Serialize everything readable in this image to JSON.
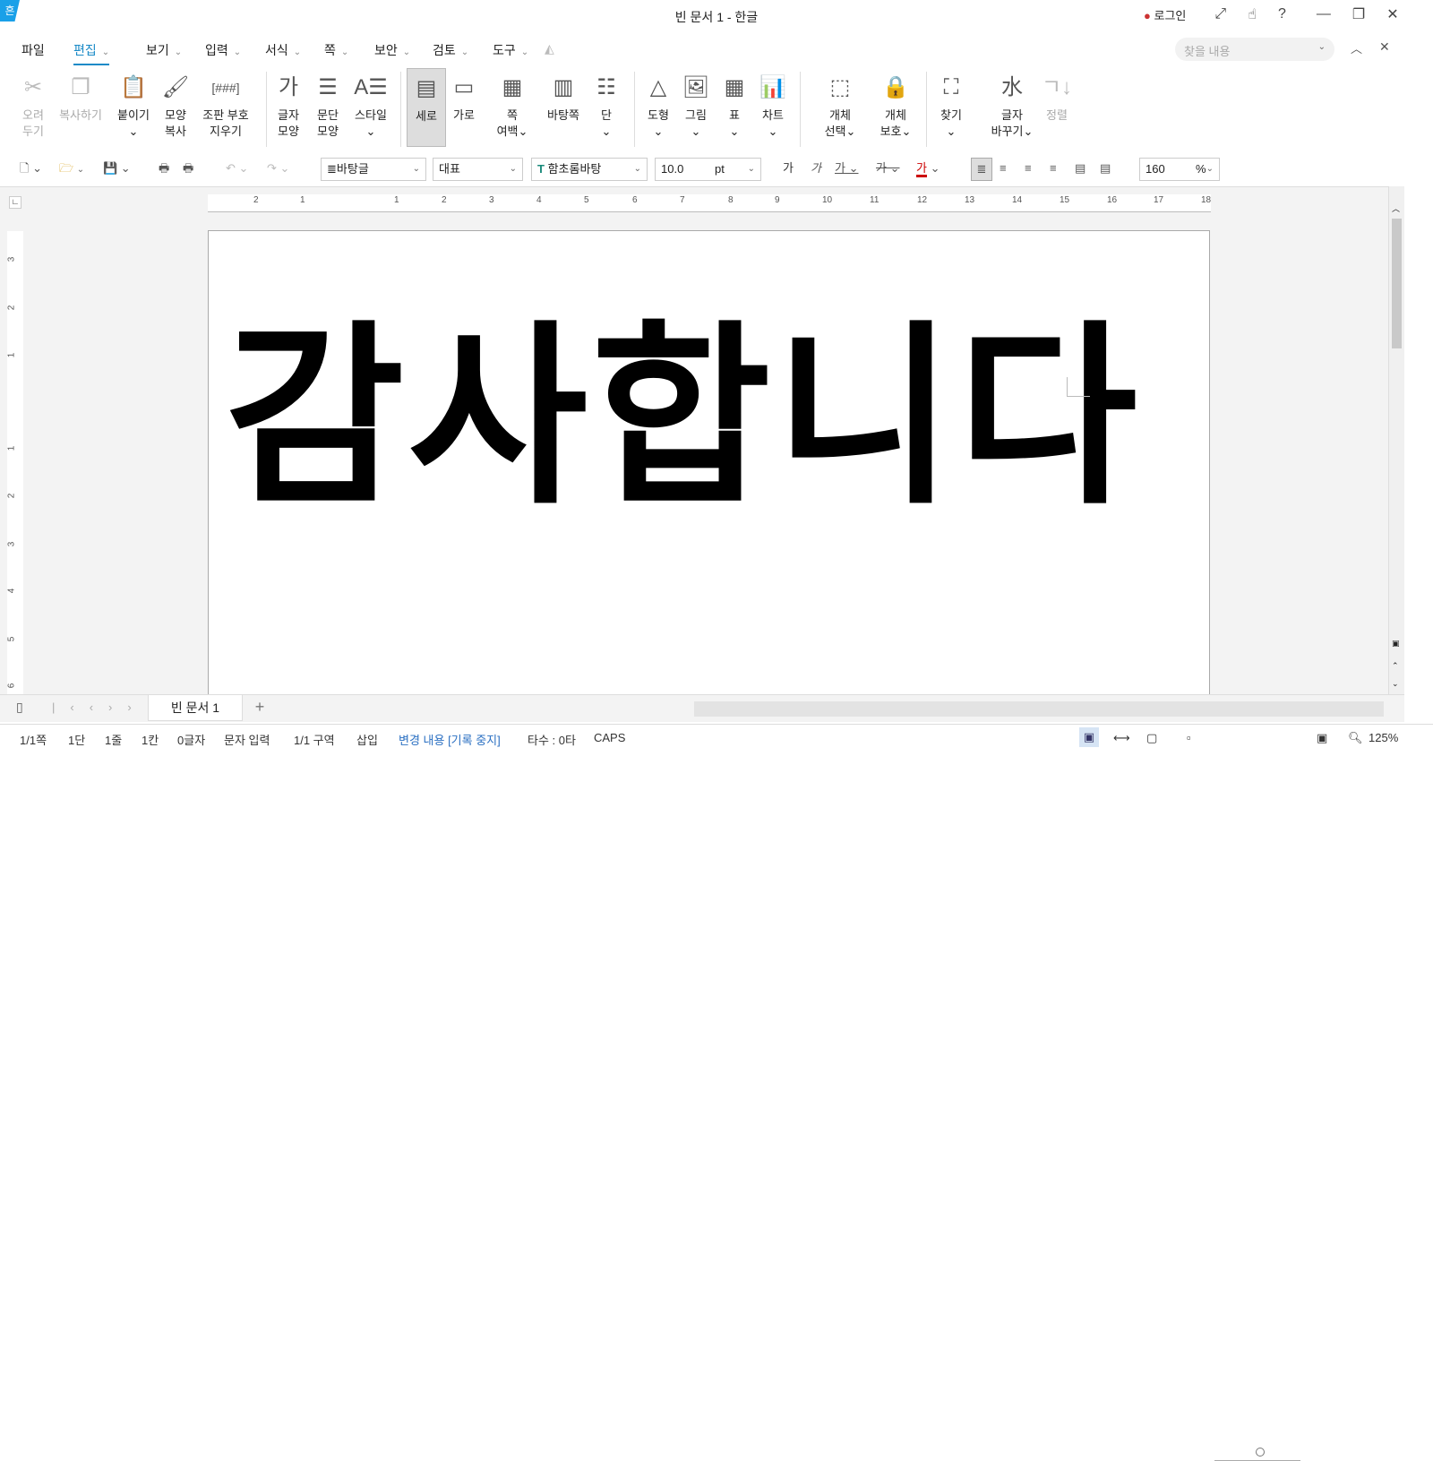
{
  "app": {
    "logo": "흔",
    "title": "빈 문서 1 - 한글",
    "login": "로그인"
  },
  "titlebar_icons": [
    "expand-icon",
    "hand-icon",
    "help-icon",
    "minimize-icon",
    "restore-icon",
    "close-icon"
  ],
  "menu": {
    "file": "파일",
    "items": [
      "편집",
      "보기",
      "입력",
      "서식",
      "쪽",
      "보안",
      "검토",
      "도구"
    ]
  },
  "search": {
    "placeholder": "찾을 내용"
  },
  "ribbon": [
    {
      "l1": "오려",
      "l2": "두기",
      "icon": "✂"
    },
    {
      "l1": "복사하기",
      "l2": "",
      "icon": "❐"
    },
    {
      "l1": "붙이기",
      "l2": "⌄",
      "icon": "📋"
    },
    {
      "l1": "모양",
      "l2": "복사",
      "icon": "🖌"
    },
    {
      "l1": "조판 부호",
      "l2": "지우기",
      "icon": "[###]"
    },
    {
      "l1": "글자",
      "l2": "모양",
      "icon": "가"
    },
    {
      "l1": "문단",
      "l2": "모양",
      "icon": "☰"
    },
    {
      "l1": "스타일",
      "l2": "⌄",
      "icon": "A☰"
    },
    {
      "l1": "세로",
      "l2": "",
      "icon": "▤"
    },
    {
      "l1": "가로",
      "l2": "",
      "icon": "▭"
    },
    {
      "l1": "쪽",
      "l2": "여백⌄",
      "icon": "▦"
    },
    {
      "l1": "바탕쪽",
      "l2": "",
      "icon": "▥"
    },
    {
      "l1": "단",
      "l2": "⌄",
      "icon": "☷"
    },
    {
      "l1": "도형",
      "l2": "⌄",
      "icon": "△"
    },
    {
      "l1": "그림",
      "l2": "⌄",
      "icon": "🖼"
    },
    {
      "l1": "표",
      "l2": "⌄",
      "icon": "▦"
    },
    {
      "l1": "차트",
      "l2": "⌄",
      "icon": "📊"
    },
    {
      "l1": "개체",
      "l2": "선택⌄",
      "icon": "⬚"
    },
    {
      "l1": "개체",
      "l2": "보호⌄",
      "icon": "🔒"
    },
    {
      "l1": "찾기",
      "l2": "⌄",
      "icon": "⛶"
    },
    {
      "l1": "글자",
      "l2": "바꾸기⌄",
      "icon": "水"
    },
    {
      "l1": "정렬",
      "l2": "",
      "icon": "ㄱ↓"
    }
  ],
  "format": {
    "style": "바탕글",
    "lang": "대표",
    "font": "함초롬바탕",
    "size": "10.0",
    "unit": "pt",
    "zoom": "160",
    "zoom_unit": "%",
    "char_buttons": [
      "가",
      "가",
      "가",
      "가",
      "가"
    ]
  },
  "ruler": {
    "h": [
      "2",
      "1",
      "1",
      "2",
      "3",
      "4",
      "5",
      "6",
      "7",
      "8",
      "9",
      "10",
      "11",
      "12",
      "13",
      "14",
      "15",
      "16",
      "17",
      "18"
    ],
    "v": [
      "3",
      "2",
      "1",
      "1",
      "2",
      "3",
      "4",
      "5",
      "6"
    ]
  },
  "document": {
    "text": "감사합니다 :)"
  },
  "tabs": {
    "doc": "빈 문서 1",
    "add": "+"
  },
  "status": {
    "page": "1/1쪽",
    "col": "1단",
    "line": "1줄",
    "pos": "1칸",
    "chars": "0글자",
    "mode": "문자 입력",
    "section": "1/1 구역",
    "insert": "삽입",
    "change": "변경 내용 [기록 중지]",
    "typing": "타수 : 0타",
    "caps": "CAPS",
    "zoom": "125%"
  }
}
